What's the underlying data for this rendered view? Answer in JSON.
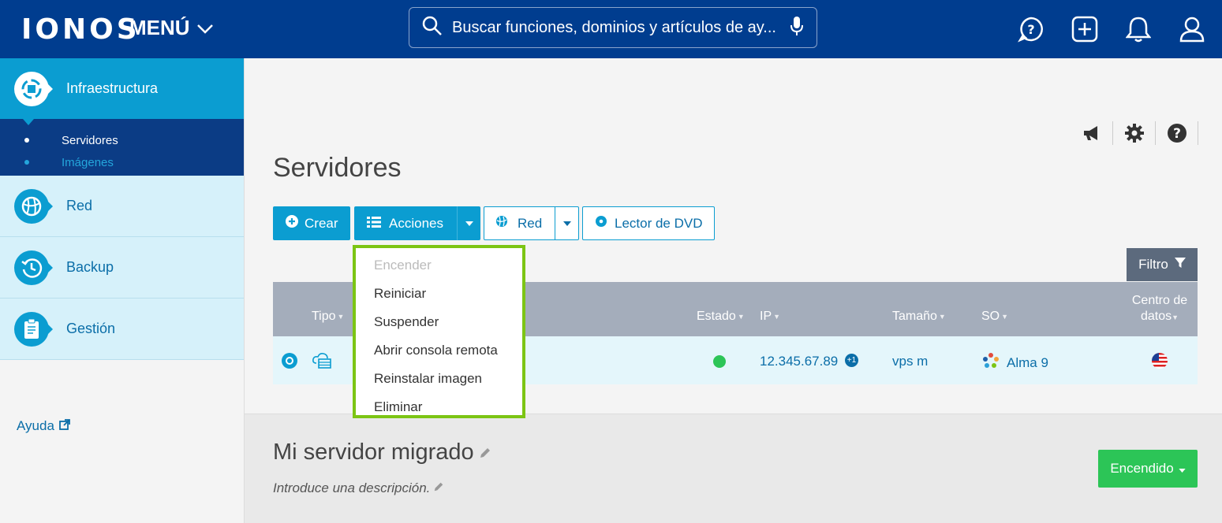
{
  "header": {
    "logo": "IONOS",
    "menu_label": "MENÚ",
    "search_placeholder": "Buscar funciones, dominios y artículos de ay..."
  },
  "sidebar": {
    "active_section": "Infraestructura",
    "sub_items": [
      "Servidores",
      "Imágenes"
    ],
    "items": [
      "Red",
      "Backup",
      "Gestión"
    ],
    "help": "Ayuda"
  },
  "main": {
    "title": "Servidores",
    "toolbar": {
      "create": "Crear",
      "actions": "Acciones",
      "network": "Red",
      "dvd": "Lector de DVD"
    },
    "filter": "Filtro",
    "table": {
      "headers": {
        "type": "Tipo",
        "status": "Estado",
        "ip": "IP",
        "size": "Tamaño",
        "os": "SO",
        "datacenter": "Centro de datos"
      },
      "row": {
        "ip": "12.345.67.89",
        "ip_extra": "+1",
        "size": "vps m",
        "os": "Alma 9",
        "status_color": "#2cc557"
      }
    },
    "actions_menu": [
      "Encender",
      "Reiniciar",
      "Suspender",
      "Abrir consola remota",
      "Reinstalar imagen",
      "Eliminar"
    ]
  },
  "detail": {
    "server_name": "Mi servidor migrado",
    "description_placeholder": "Introduce una descripción.",
    "power_label": "Encendido"
  },
  "colors": {
    "header_bg": "#003d8f",
    "accent": "#0b9dd1",
    "highlight_border": "#7cc514",
    "power_green": "#2cc557"
  }
}
